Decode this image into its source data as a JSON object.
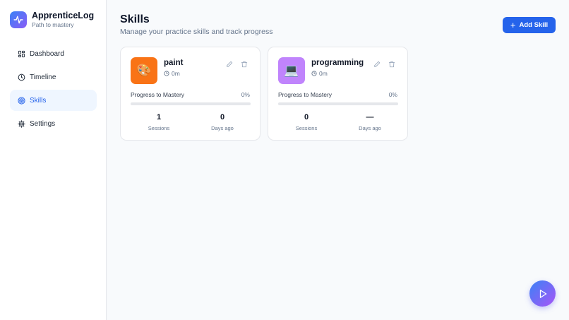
{
  "app": {
    "title": "ApprenticeLog",
    "subtitle": "Path to mastery"
  },
  "sidebar": {
    "items": [
      {
        "label": "Dashboard",
        "icon": "grid-icon",
        "active": false
      },
      {
        "label": "Timeline",
        "icon": "clock-icon",
        "active": false
      },
      {
        "label": "Skills",
        "icon": "target-icon",
        "active": true
      },
      {
        "label": "Settings",
        "icon": "gear-icon",
        "active": false
      }
    ]
  },
  "header": {
    "title": "Skills",
    "subtitle": "Manage your practice skills and track progress",
    "add_button_label": "Add Skill"
  },
  "skills": [
    {
      "name": "paint",
      "emoji": "🎨",
      "icon_bg": "#f97316",
      "time": "0m",
      "progress_label": "Progress to Mastery",
      "progress_pct": "0%",
      "progress_value": 0,
      "sessions_value": "1",
      "sessions_label": "Sessions",
      "days_value": "0",
      "days_label": "Days ago"
    },
    {
      "name": "programming",
      "emoji": "💻",
      "icon_bg": "#c084fc",
      "time": "0m",
      "progress_label": "Progress to Mastery",
      "progress_pct": "0%",
      "progress_value": 0,
      "sessions_value": "0",
      "sessions_label": "Sessions",
      "days_value": "—",
      "days_label": "Days ago"
    }
  ],
  "colors": {
    "accent": "#2563eb",
    "active_nav_bg": "#eff6ff"
  }
}
